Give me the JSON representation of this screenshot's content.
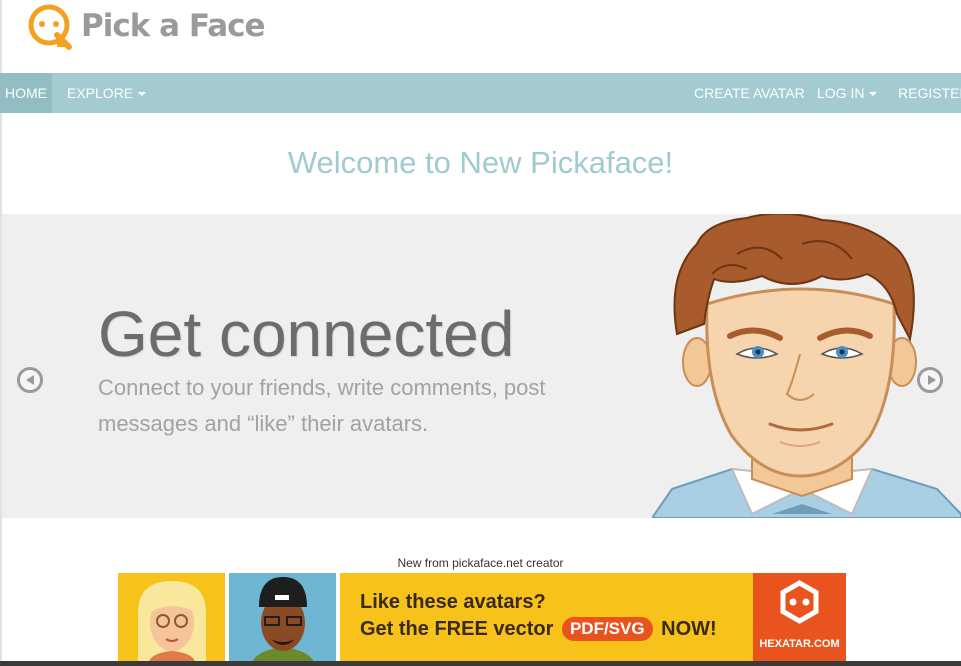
{
  "header": {
    "logo_text": "Pick a Face",
    "logo_color": "#f4a11f"
  },
  "nav": {
    "home": "HOME",
    "explore": "EXPLORE",
    "create_avatar": "CREATE AVATAR",
    "log_in": "LOG IN",
    "register": "REGISTER",
    "bar_color": "#a3cbd0"
  },
  "welcome": "Welcome to New Pickaface!",
  "carousel": {
    "title": "Get connected",
    "text": "Connect to your friends, write comments, post messages and “like” their avatars."
  },
  "promo": {
    "caption": "New from pickaface.net creator",
    "line1": "Like these avatars?",
    "line2_prefix": "Get the FREE vector",
    "line2_pill": "PDF/SVG",
    "line2_suffix": "NOW!",
    "brand": "HEXATAR.COM",
    "brand_color": "#e9541e"
  }
}
